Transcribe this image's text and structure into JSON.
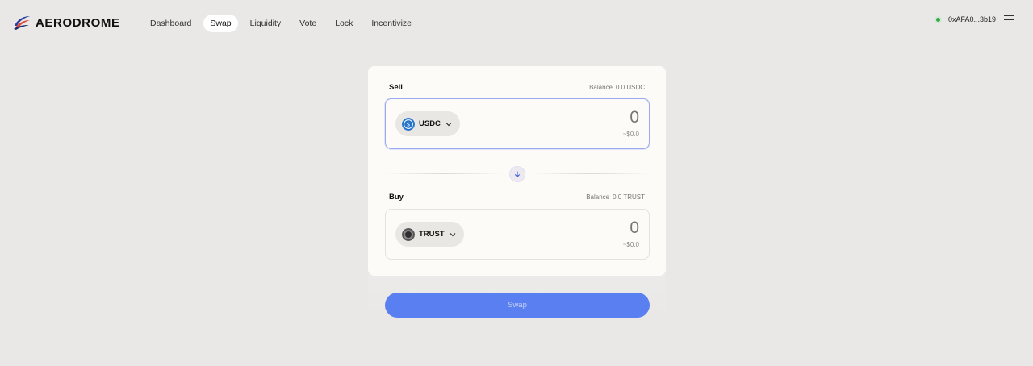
{
  "app": {
    "name": "AERODROME"
  },
  "nav": {
    "items": [
      {
        "label": "Dashboard",
        "active": false
      },
      {
        "label": "Swap",
        "active": true
      },
      {
        "label": "Liquidity",
        "active": false
      },
      {
        "label": "Vote",
        "active": false
      },
      {
        "label": "Lock",
        "active": false
      },
      {
        "label": "Incentivize",
        "active": false
      }
    ]
  },
  "wallet": {
    "address": "0xAFA0...3b19",
    "status_color": "#3aa64a"
  },
  "sell": {
    "label": "Sell",
    "balance_label": "Balance",
    "balance_value": "0.0 USDC",
    "token": "USDC",
    "token_icon": "usdc-icon",
    "amount_placeholder": "0",
    "usd_value": "~$0.0"
  },
  "buy": {
    "label": "Buy",
    "balance_label": "Balance",
    "balance_value": "0.0 TRUST",
    "token": "TRUST",
    "token_icon": "trust-icon",
    "amount_placeholder": "0",
    "usd_value": "~$0.0"
  },
  "swap_direction_icon": "arrow-down-icon",
  "swap_button": {
    "label": "Swap"
  },
  "colors": {
    "accent": "#5a7ff0",
    "background": "#e9e8e6",
    "card": "#fdfbf8"
  }
}
